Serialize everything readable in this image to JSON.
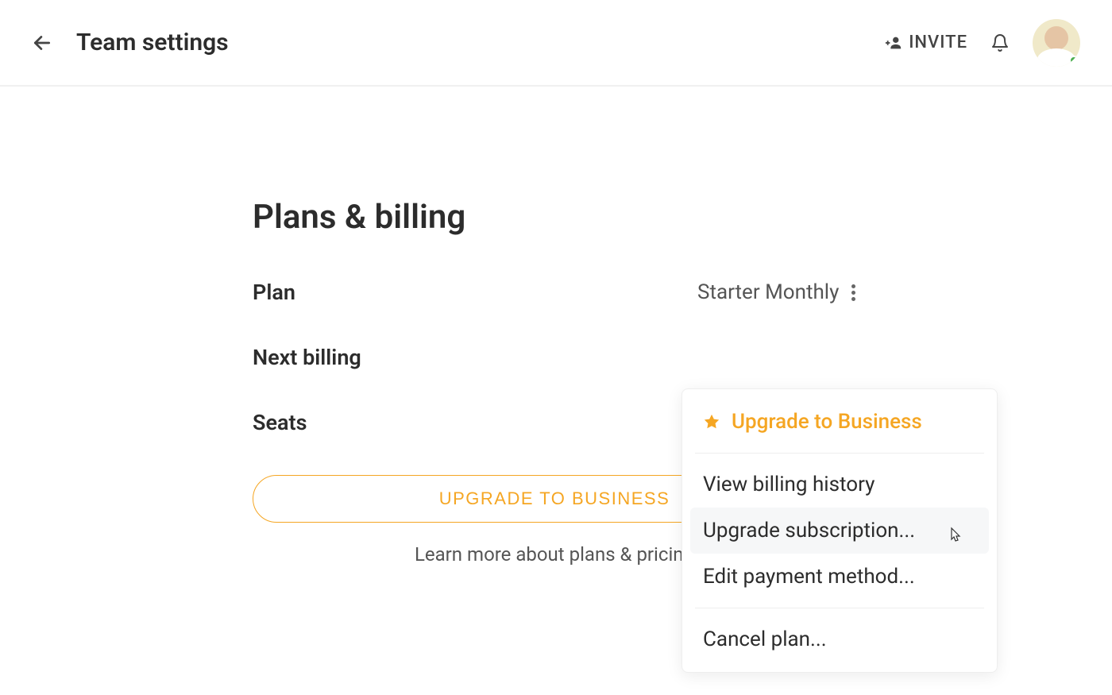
{
  "header": {
    "title": "Team settings",
    "invite_label": "INVITE"
  },
  "section": {
    "title": "Plans & billing"
  },
  "rows": {
    "plan_label": "Plan",
    "plan_value": "Starter Monthly",
    "next_billing_label": "Next billing",
    "seats_label": "Seats"
  },
  "cta": {
    "upgrade_button": "UPGRADE TO BUSINESS",
    "learn_more": "Learn more about plans & pricing"
  },
  "dropdown": {
    "featured": "Upgrade to Business",
    "billing_history": "View billing history",
    "upgrade_subscription": "Upgrade subscription...",
    "edit_payment": "Edit payment method...",
    "cancel_plan": "Cancel plan..."
  }
}
